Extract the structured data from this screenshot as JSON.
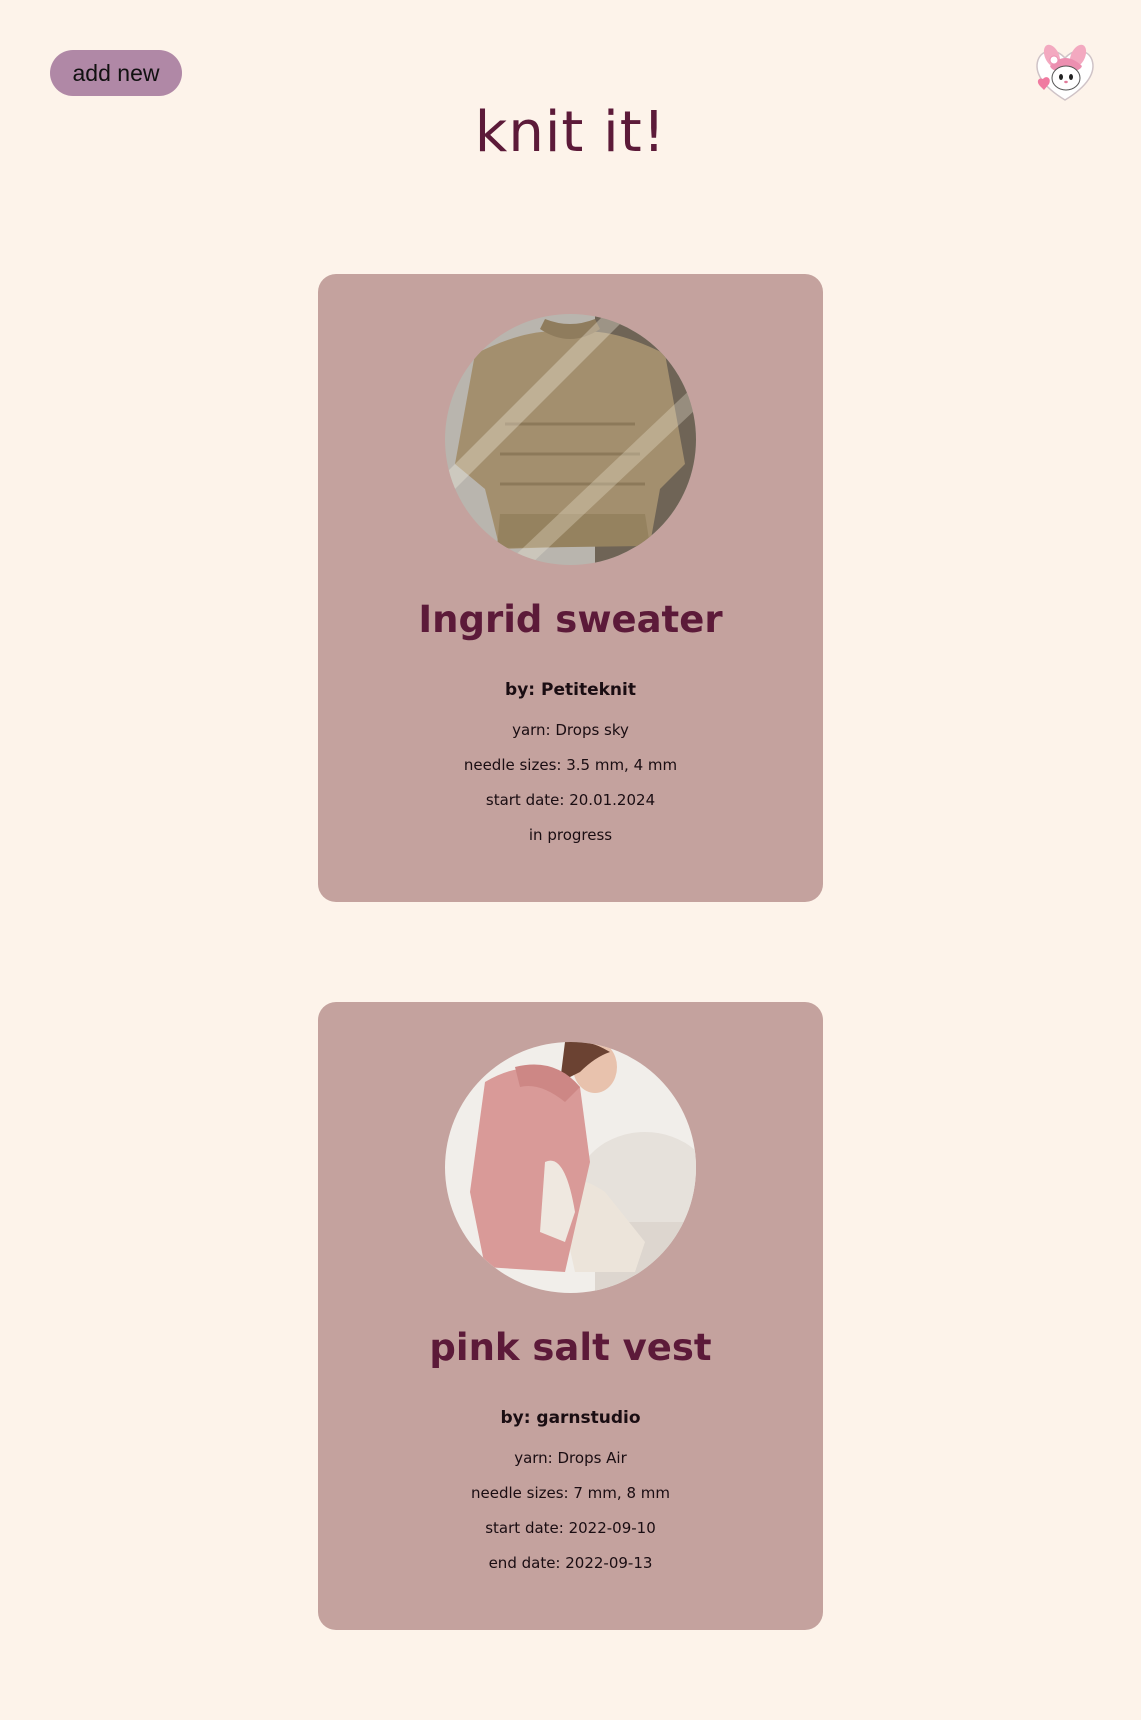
{
  "header": {
    "add_new_label": "add new",
    "title": "knit it!",
    "avatar_icon": "bunny-mascot-icon"
  },
  "projects": [
    {
      "name": "Ingrid sweater",
      "author": "by: Petiteknit",
      "yarn": "yarn: Drops sky",
      "needles": "needle sizes: 3.5 mm, 4 mm",
      "start": "start date: 20.01.2024",
      "status": "in progress"
    },
    {
      "name": "pink salt vest",
      "author": "by: garnstudio",
      "yarn": "yarn: Drops Air",
      "needles": "needle sizes: 7 mm, 8 mm",
      "start": "start date: 2022-09-10",
      "status": "end date: 2022-09-13"
    }
  ],
  "colors": {
    "background": "#fdf3ea",
    "card": "#c4a29e",
    "accent": "#5c1a39",
    "button": "#b088a6"
  }
}
